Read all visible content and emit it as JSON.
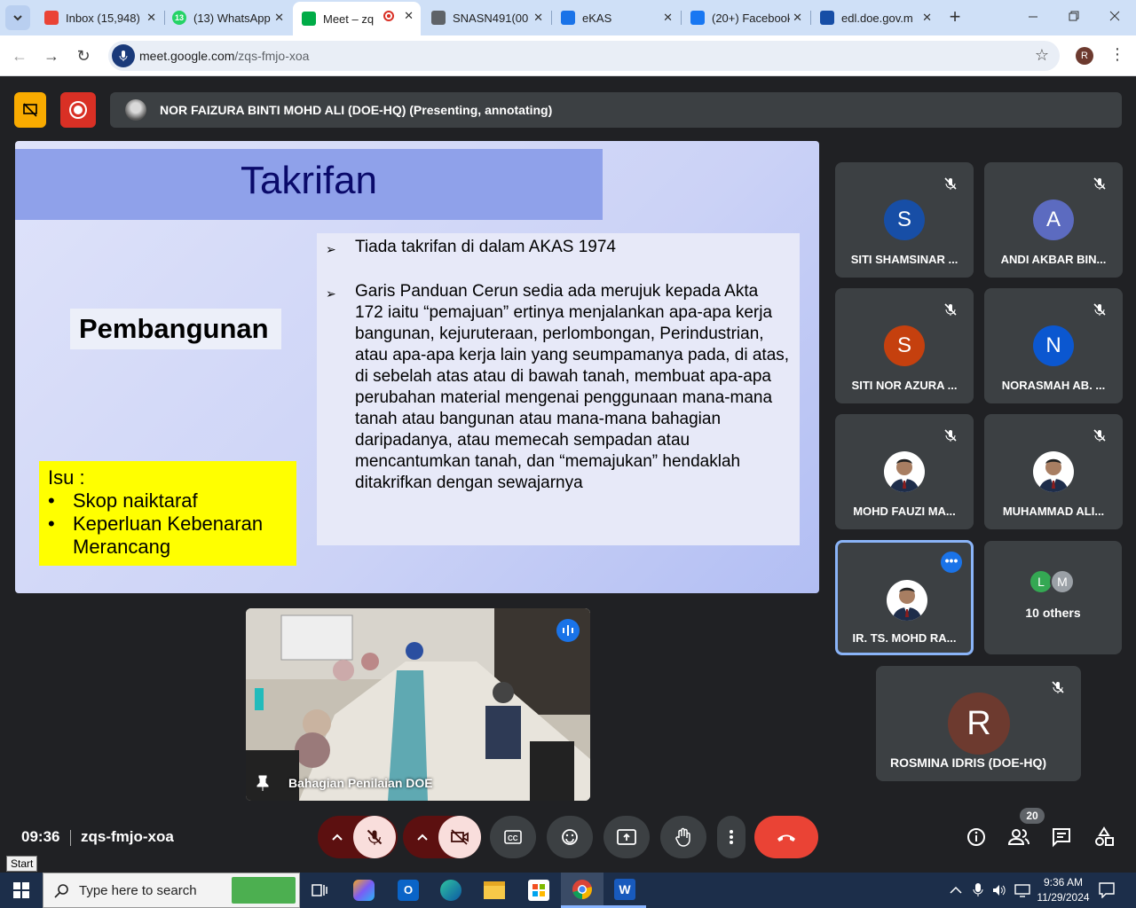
{
  "browser": {
    "tabs": [
      {
        "label": "Inbox (15,948)",
        "icon": "gmail-icon",
        "color": "#ea4335"
      },
      {
        "label": "(13) WhatsApp",
        "icon": "whatsapp-icon",
        "color": "#25d366",
        "badge": "13"
      },
      {
        "label": "Meet – zq",
        "icon": "meet-icon",
        "color": "#00ac47",
        "active": true
      },
      {
        "label": "SNASN491(00",
        "icon": "globe-icon",
        "color": "#5f6368"
      },
      {
        "label": "eKAS",
        "icon": "ekas-icon",
        "color": "#1a73e8"
      },
      {
        "label": "(20+) Facebook",
        "icon": "facebook-icon",
        "color": "#1877f2"
      },
      {
        "label": "edl.doe.gov.m",
        "icon": "doe-icon",
        "color": "#174ea6"
      }
    ],
    "url_host": "meet.google.com",
    "url_path": "/zqs-fmjo-xoa",
    "profile_initial": "R"
  },
  "presenter": {
    "name": "NOR FAIZURA BINTI MOHD ALI (DOE-HQ) (Presenting, annotating)"
  },
  "slide": {
    "title": "Takrifan",
    "keyword": "Pembangunan",
    "issue_heading": "Isu :",
    "issue_items": [
      "Skop naiktaraf",
      "Keperluan Kebenaran Merancang"
    ],
    "bullets": [
      "Tiada takrifan di dalam AKAS 1974",
      "Garis Panduan Cerun sedia ada merujuk kepada Akta 172 iaitu “pemajuan” ertinya menjalankan apa-apa kerja bangunan, kejuruteraan, perlombongan, Perindustrian, atau apa-apa kerja lain yang seumpamanya pada, di atas, di sebelah atas atau di bawah tanah, membuat apa-apa perubahan material mengenai penggunaan mana-mana tanah atau bangunan atau mana-mana bahagian daripadanya, atau memecah sempadan atau mencantumkan tanah, dan “memajukan” hendaklah ditakrifkan dengan sewajarnya"
    ]
  },
  "camera": {
    "label": "Bahagian Penilaian DOE"
  },
  "participants": [
    {
      "name": "SITI SHAMSINAR ...",
      "initial": "S",
      "color": "#174ea6"
    },
    {
      "name": "ANDI AKBAR BIN...",
      "initial": "A",
      "color": "#5c6bc0"
    },
    {
      "name": "SITI NOR AZURA ...",
      "initial": "S",
      "color": "#c5400e"
    },
    {
      "name": "NORASMAH AB. ...",
      "initial": "N",
      "color": "#0b57d0"
    },
    {
      "name": "MOHD FAUZI MA...",
      "initial": "",
      "color": "#ffffff",
      "photo": true
    },
    {
      "name": "MUHAMMAD ALI...",
      "initial": "",
      "color": "#ffffff",
      "photo": true
    },
    {
      "name": "IR. TS. MOHD RA...",
      "initial": "",
      "color": "#ffffff",
      "photo": true,
      "highlight": true
    }
  ],
  "others": {
    "label": "10 others",
    "initials": [
      "L",
      "M"
    ]
  },
  "self_tile": {
    "name": "ROSMINA IDRIS (DOE-HQ)",
    "initial": "R",
    "color": "#6d3a2f"
  },
  "bottom": {
    "time": "09:36",
    "meeting_code": "zqs-fmjo-xoa",
    "participant_count": "20",
    "tooltip": "Start"
  },
  "taskbar": {
    "search_placeholder": "Type here to search",
    "clock_time": "9:36 AM",
    "clock_date": "11/29/2024"
  }
}
